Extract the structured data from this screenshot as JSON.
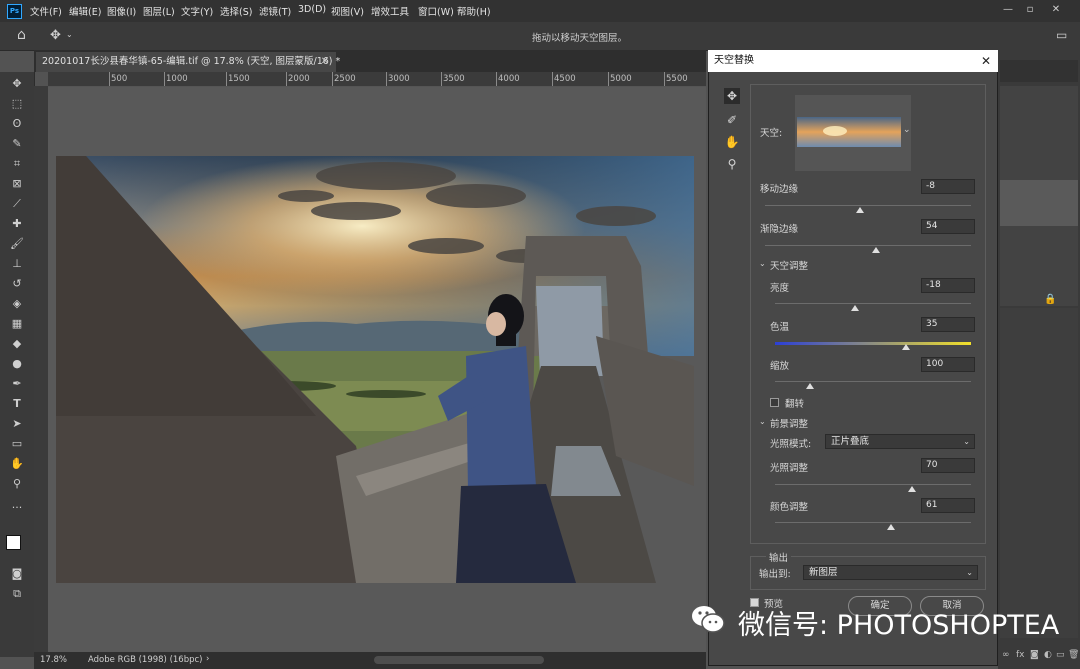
{
  "menubar": {
    "items": [
      "文件(F)",
      "编辑(E)",
      "图像(I)",
      "图层(L)",
      "文字(Y)",
      "选择(S)",
      "滤镜(T)",
      "3D(D)",
      "视图(V)",
      "增效工具",
      "窗口(W)",
      "帮助(H)"
    ],
    "logo": "Ps"
  },
  "optionsbar": {
    "hint": "拖动以移动天空图层。"
  },
  "document": {
    "tab_title": "20201017长沙县春华镇-65-编辑.tif @ 17.8% (天空, 图层蒙版/16) *",
    "zoom": "17.8%",
    "profile": "Adobe RGB (1998) (16bpc)",
    "ruler_ticks": [
      "500",
      "1000",
      "1500",
      "2000",
      "2500",
      "3000",
      "3500",
      "4000",
      "4500",
      "5000",
      "5500"
    ]
  },
  "tools": [
    "move-tool",
    "marquee-tool",
    "lasso-tool",
    "quick-select-tool",
    "crop-tool",
    "frame-tool",
    "eyedropper-tool",
    "healing-tool",
    "brush-tool",
    "stamp-tool",
    "history-brush-tool",
    "eraser-tool",
    "gradient-tool",
    "blur-tool",
    "dodge-tool",
    "pen-tool",
    "type-tool",
    "path-select-tool",
    "shape-tool",
    "hand-tool",
    "zoom-tool",
    "more-tools"
  ],
  "dialog": {
    "title": "天空替换",
    "sky_label": "天空:",
    "shift_edge": {
      "label": "移动边缘",
      "value": "-8"
    },
    "fade_edge": {
      "label": "渐隐边缘",
      "value": "54"
    },
    "sky_adjust": {
      "header": "天空调整",
      "brightness": {
        "label": "亮度",
        "value": "-18"
      },
      "temperature": {
        "label": "色温",
        "value": "35"
      },
      "scale": {
        "label": "缩放",
        "value": "100"
      },
      "flip_label": "翻转"
    },
    "foreground": {
      "header": "前景调整",
      "mode_label": "光照模式:",
      "mode_value": "正片叠底",
      "lighting": {
        "label": "光照调整",
        "value": "70"
      },
      "color": {
        "label": "颜色调整",
        "value": "61"
      }
    },
    "output": {
      "header": "输出",
      "output_to_label": "输出到:",
      "output_to_value": "新图层"
    },
    "preview_label": "预览",
    "ok_label": "确定",
    "cancel_label": "取消",
    "slider_levels": {
      "shift_edge": 0.46,
      "fade_edge": 0.54,
      "brightness": 0.41,
      "temperature": 0.67,
      "scale": 0.18,
      "lighting": 0.7,
      "color": 0.59
    }
  },
  "watermark": "微信号: PHOTOSHOPTEA",
  "colors": {
    "accent": "#31a8ff",
    "temperature_left": "#2b3fd6",
    "temperature_right": "#f2e02a"
  }
}
